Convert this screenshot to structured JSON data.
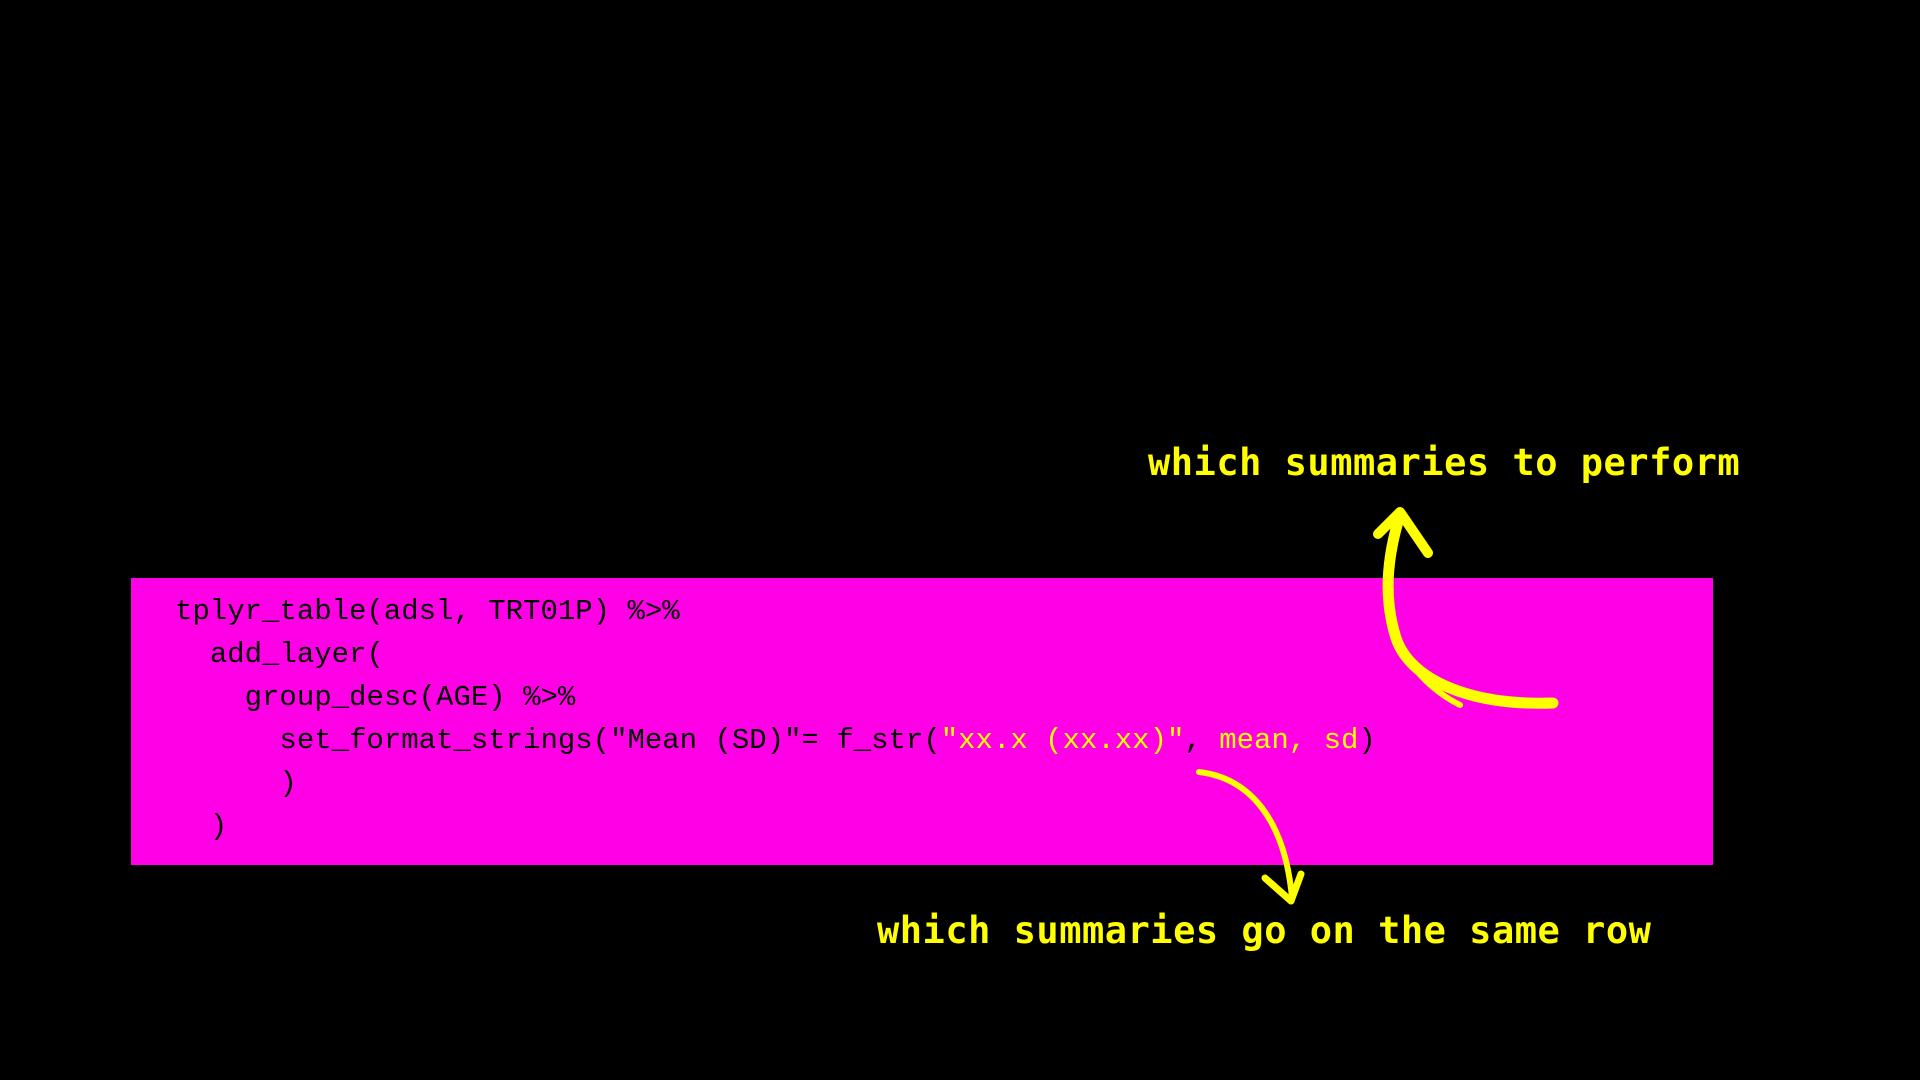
{
  "annotations": {
    "top": "which summaries to perform",
    "bottom": "which summaries go on the same row"
  },
  "code": {
    "line1": "tplyr_table(adsl, TRT01P) %>%",
    "line2_indent": "  ",
    "line2": "add_layer(",
    "line3_indent": "    ",
    "line3": "group_desc(AGE) %>%",
    "line4_indent": "      ",
    "line4_pre": "set_format_strings(\"Mean (SD)\"= f_str(",
    "line4_fmt": "\"xx.x (xx.xx)\"",
    "line4_sep": ", ",
    "line4_args": "mean, sd",
    "line4_post": ")",
    "line5_indent": "      ",
    "line5": ")",
    "line6_indent": "  ",
    "line6": ")"
  },
  "colors": {
    "background": "#000000",
    "code_box": "#FF00E6",
    "highlight": "#FFFF00",
    "code_text": "#000000"
  }
}
